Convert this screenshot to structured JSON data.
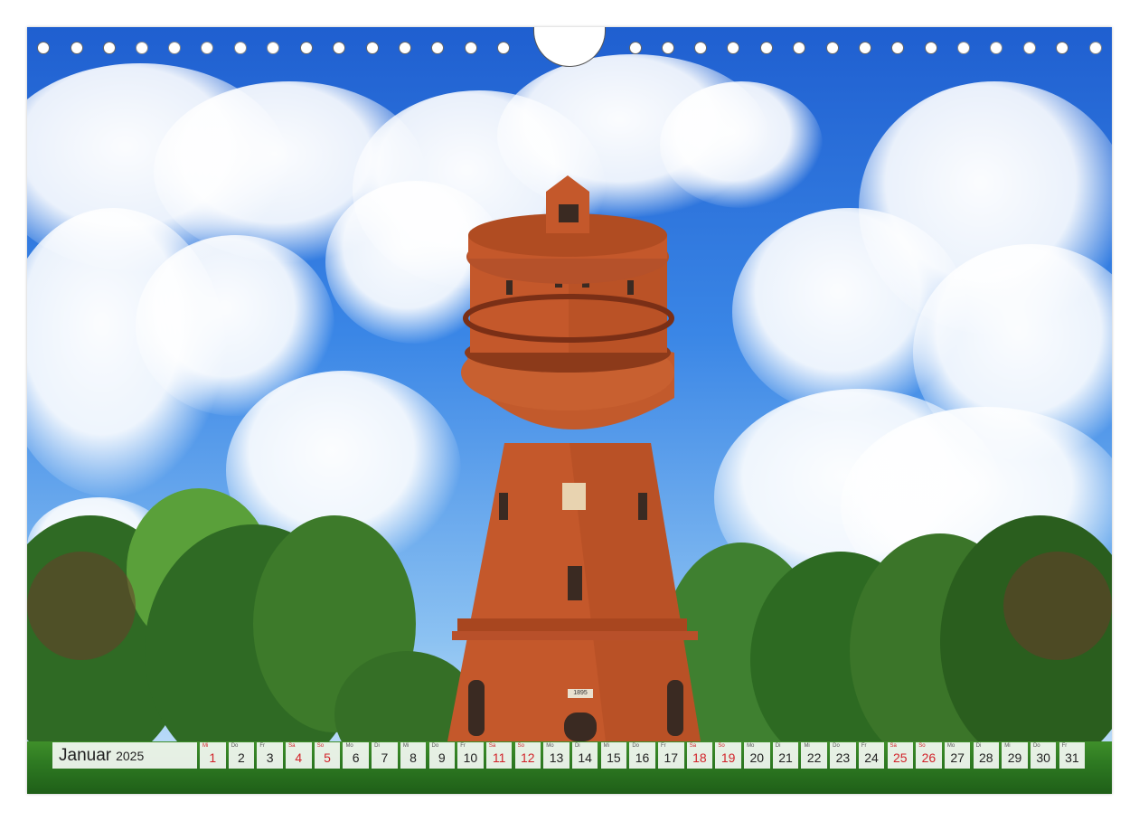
{
  "calendar": {
    "month": "Januar",
    "year": "2025",
    "days": [
      {
        "wd": "Mi",
        "num": "1",
        "red": true
      },
      {
        "wd": "Do",
        "num": "2",
        "red": false
      },
      {
        "wd": "Fr",
        "num": "3",
        "red": false
      },
      {
        "wd": "Sa",
        "num": "4",
        "red": true
      },
      {
        "wd": "So",
        "num": "5",
        "red": true
      },
      {
        "wd": "Mo",
        "num": "6",
        "red": false
      },
      {
        "wd": "Di",
        "num": "7",
        "red": false
      },
      {
        "wd": "Mi",
        "num": "8",
        "red": false
      },
      {
        "wd": "Do",
        "num": "9",
        "red": false
      },
      {
        "wd": "Fr",
        "num": "10",
        "red": false
      },
      {
        "wd": "Sa",
        "num": "11",
        "red": true
      },
      {
        "wd": "So",
        "num": "12",
        "red": true
      },
      {
        "wd": "Mo",
        "num": "13",
        "red": false
      },
      {
        "wd": "Di",
        "num": "14",
        "red": false
      },
      {
        "wd": "Mi",
        "num": "15",
        "red": false
      },
      {
        "wd": "Do",
        "num": "16",
        "red": false
      },
      {
        "wd": "Fr",
        "num": "17",
        "red": false
      },
      {
        "wd": "Sa",
        "num": "18",
        "red": true
      },
      {
        "wd": "So",
        "num": "19",
        "red": true
      },
      {
        "wd": "Mo",
        "num": "20",
        "red": false
      },
      {
        "wd": "Di",
        "num": "21",
        "red": false
      },
      {
        "wd": "Mi",
        "num": "22",
        "red": false
      },
      {
        "wd": "Do",
        "num": "23",
        "red": false
      },
      {
        "wd": "Fr",
        "num": "24",
        "red": false
      },
      {
        "wd": "Sa",
        "num": "25",
        "red": true
      },
      {
        "wd": "So",
        "num": "26",
        "red": true
      },
      {
        "wd": "Mo",
        "num": "27",
        "red": false
      },
      {
        "wd": "Di",
        "num": "28",
        "red": false
      },
      {
        "wd": "Mi",
        "num": "29",
        "red": false
      },
      {
        "wd": "Do",
        "num": "30",
        "red": false
      },
      {
        "wd": "Fr",
        "num": "31",
        "red": false
      }
    ]
  },
  "photo": {
    "tower_plaque": "1895"
  },
  "colors": {
    "brick": "#c4582b",
    "weekend_red": "#d2232a",
    "sky_blue": "#2f6fd8",
    "foliage": "#3d7a2a"
  }
}
